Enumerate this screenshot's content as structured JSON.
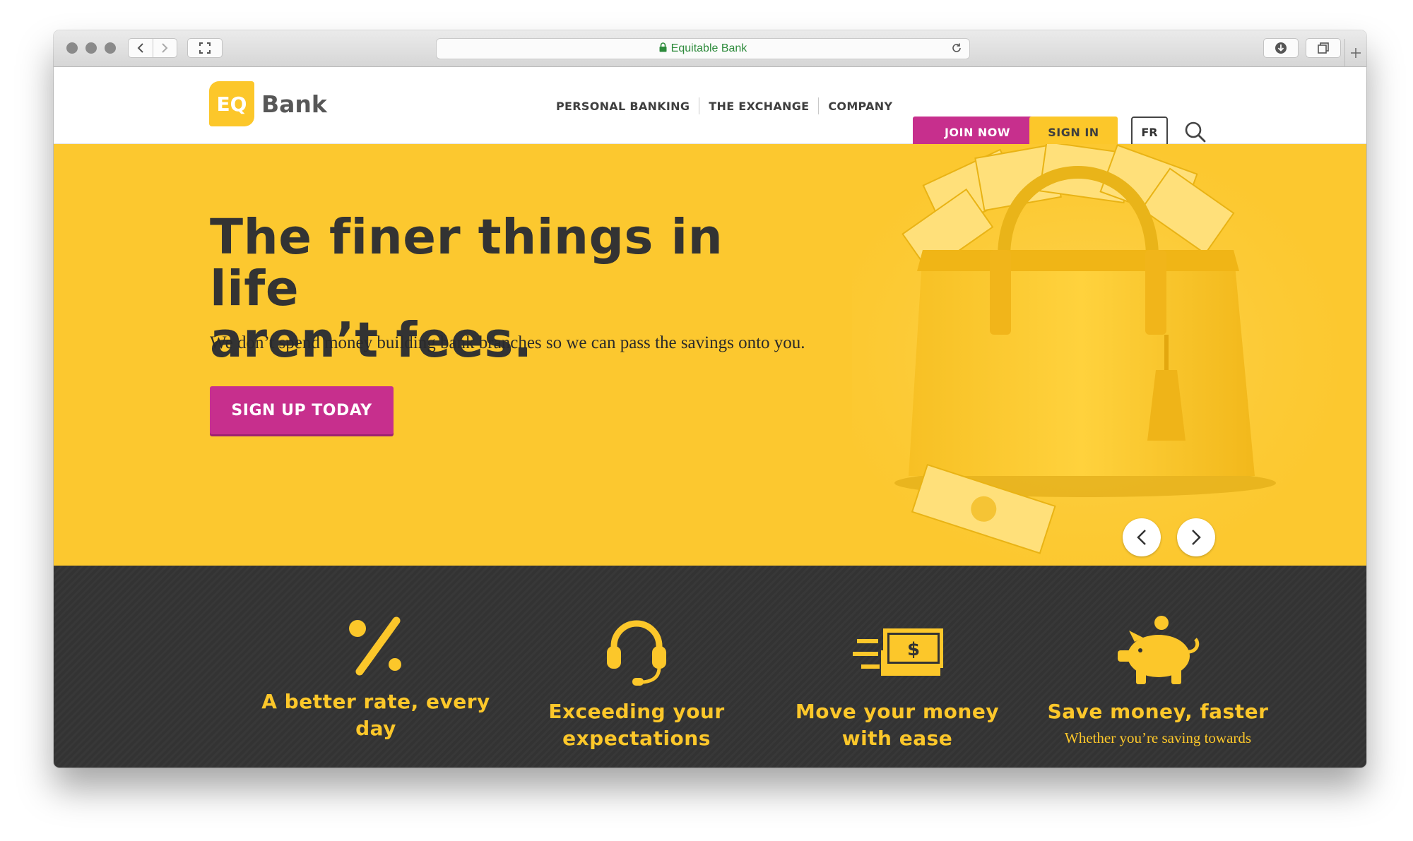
{
  "browser": {
    "url_title": "Equitable Bank",
    "secure": true
  },
  "site": {
    "logo_mark": "EQ",
    "logo_word": "Bank",
    "nav": [
      "PERSONAL BANKING",
      "THE EXCHANGE",
      "COMPANY"
    ],
    "join_label": "JOIN NOW",
    "signin_label": "SIGN IN",
    "lang_label": "FR"
  },
  "hero": {
    "title_line1": "The finer things in life",
    "title_line2": "aren’t fees.",
    "subtitle": "We don’t spend money building bank branches so we can pass the savings onto you.",
    "cta_label": "SIGN UP TODAY"
  },
  "features": [
    {
      "icon": "percent-icon",
      "title_line1": "A better rate, every",
      "title_line2": "day",
      "text": ""
    },
    {
      "icon": "headset-icon",
      "title_line1": "Exceeding your",
      "title_line2": "expectations",
      "text": ""
    },
    {
      "icon": "money-transfer-icon",
      "title_line1": "Move your money",
      "title_line2": "with ease",
      "text": ""
    },
    {
      "icon": "piggy-bank-icon",
      "title_line1": "Save money, faster",
      "title_line2": "",
      "text": "Whether you’re saving towards"
    }
  ],
  "colors": {
    "brand_yellow": "#fcc72a",
    "brand_magenta": "#c72f8d",
    "dark": "#333333"
  }
}
